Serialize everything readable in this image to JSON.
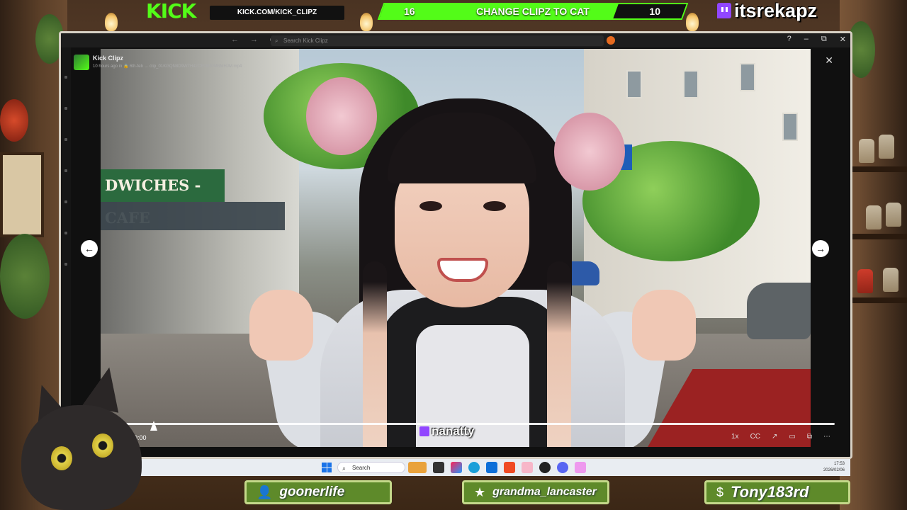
{
  "overlay": {
    "kick_logo": "KICK",
    "kick_url": "KICK.COM/KICK_CLIPZ",
    "poll": {
      "left_count": "16",
      "title": "CHANGE CLIPZ TO CAT",
      "right_count": "10"
    },
    "twitch_handle": "itsrekapz",
    "accent": "#53fc18"
  },
  "browser": {
    "search_placeholder": "Search Kick Clipz",
    "window_controls": {
      "help": "?",
      "minimize": "–",
      "restore": "⧉",
      "close": "✕"
    }
  },
  "clip": {
    "channel": "Kick Clipz",
    "meta": "10 hours ago in 🔒 6th-feb → clip_01KGQN8D9W7H42CE98D0MBMHJM.mp4",
    "close": "✕",
    "prev": "←",
    "next": "→",
    "video_sign": "DWICHES - CAFE",
    "watermark": "nanatty",
    "time": "/ 0:00",
    "progress": 0.0,
    "controls": {
      "speed": "1x",
      "captions": "CC",
      "share": "↗",
      "theater": "▭",
      "pip": "⧉",
      "more": "⋯"
    }
  },
  "taskbar": {
    "search": "Search",
    "clock_time": "17:53",
    "clock_date": "2026/02/06"
  },
  "chat_badges": [
    {
      "icon": "person-icon",
      "glyph": "👤",
      "name": "goonerlife"
    },
    {
      "icon": "star-icon",
      "glyph": "★",
      "name": "grandma_lancaster"
    },
    {
      "icon": "dollar-icon",
      "glyph": "$",
      "name": "Tony183rd"
    }
  ]
}
